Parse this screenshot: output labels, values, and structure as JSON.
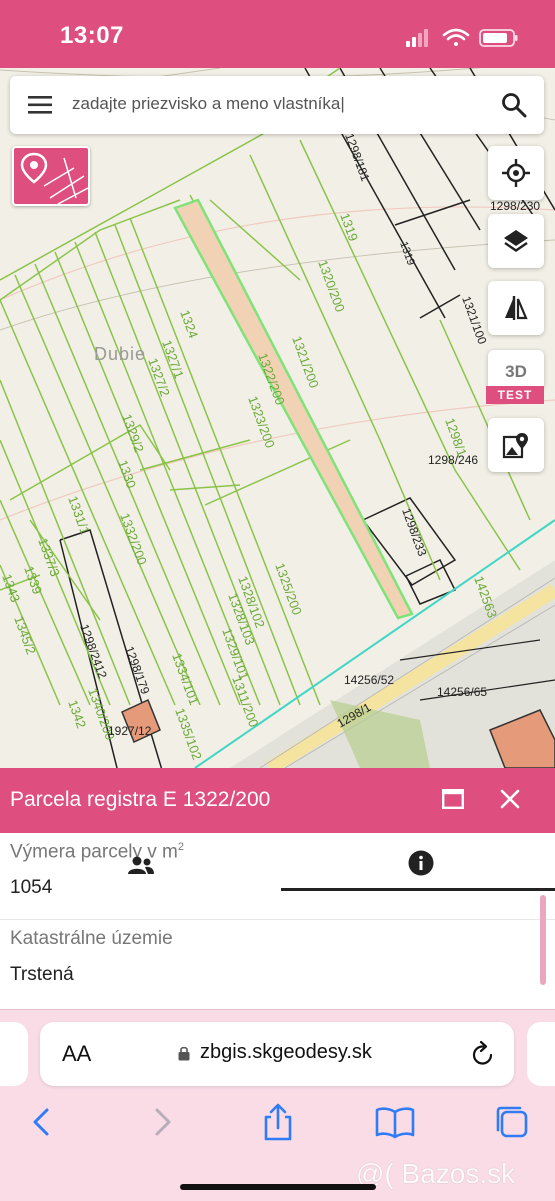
{
  "status_bar": {
    "time": "13:07"
  },
  "search": {
    "placeholder": "zadajte priezvisko a meno vlastníka|"
  },
  "map": {
    "place_name": "Dubie",
    "parcel_labels": [
      "1319",
      "1320/200",
      "1321/200",
      "1322/200",
      "1323/200",
      "1324",
      "1327/1",
      "1327/2",
      "1329/2",
      "1330",
      "1331/1",
      "1332/200",
      "1337/3",
      "1339",
      "1343",
      "1345/2",
      "1328/102",
      "1328/103",
      "1329/101",
      "1325/200",
      "1334/101",
      "1335/102",
      "1311/200",
      "1298/2412",
      "1298/179",
      "1340/200",
      "1342",
      "1927/12",
      "1298/181",
      "1298/1",
      "1298/246",
      "1298/233",
      "1298/230",
      "1321/100",
      "142563",
      "14256/52",
      "14256/65",
      "1298/1"
    ]
  },
  "controls": {
    "label_3d": "3D",
    "test_badge": "TEST"
  },
  "panel": {
    "title": "Parcela registra E 1322/200",
    "area_label": "Výmera parcely v m",
    "area_label_sup": "2",
    "area_value": "1054",
    "cadastral_label": "Katastrálne územie",
    "cadastral_value": "Trstená"
  },
  "browser": {
    "aa": "AA",
    "url": "zbgis.skgeodesy.sk"
  },
  "watermark": "@( Bazos.sk",
  "colors": {
    "accent": "#de4f7f",
    "parcel_line": "#8bc34a",
    "highlight_fill": "#f2d2b4",
    "highlight_stroke": "#7fe37a"
  },
  "icons": [
    "menu-icon",
    "search-icon",
    "locate-icon",
    "layers-icon",
    "compare-icon",
    "map-pin-icon",
    "owners-icon",
    "info-icon",
    "maximize-icon",
    "close-icon",
    "lock-icon",
    "reload-icon",
    "back-icon",
    "forward-icon",
    "share-icon",
    "bookmarks-icon",
    "tabs-icon"
  ]
}
